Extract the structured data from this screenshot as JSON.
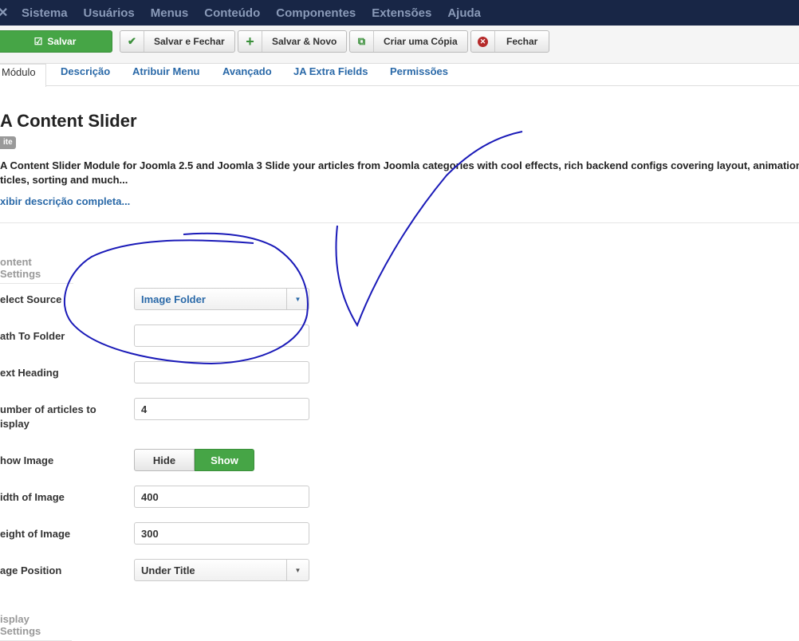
{
  "nav": {
    "items": [
      "Sistema",
      "Usuários",
      "Menus",
      "Conteúdo",
      "Componentes",
      "Extensões",
      "Ajuda"
    ]
  },
  "toolbar": {
    "save": "Salvar",
    "save_close": "Salvar e Fechar",
    "save_new": "Salvar & Novo",
    "save_copy": "Criar uma Cópia",
    "close": "Fechar"
  },
  "tabs": [
    "Módulo",
    "Descrição",
    "Atribuir Menu",
    "Avançado",
    "JA Extra Fields",
    "Permissões"
  ],
  "module": {
    "title": "A Content Slider",
    "badge": "ite",
    "description_line1": "A Content Slider Module for Joomla 2.5 and Joomla 3 Slide your articles from Joomla categories with cool effects, rich backend configs covering layout, animation",
    "description_line2": "ticles, sorting and much...",
    "more_link": "xibir descrição completa..."
  },
  "form": {
    "content_legend": "ontent Settings",
    "select_source_label": "elect Source",
    "select_source_value": "Image Folder",
    "path_label": "ath To Folder",
    "path_value": "",
    "heading_label": "ext Heading",
    "heading_value": "",
    "num_articles_label_1": "umber of articles to",
    "num_articles_label_2": "isplay",
    "num_articles_value": "4",
    "show_image_label": "how Image",
    "hide": "Hide",
    "show": "Show",
    "width_label": "idth of Image",
    "width_value": "400",
    "height_label": "eight of Image",
    "height_value": "300",
    "position_label": "age Position",
    "position_value": "Under Title",
    "display_legend": "isplay Settings"
  },
  "colors": {
    "nav": "#182646",
    "link": "#2a69a8",
    "green": "#46a546",
    "ink": "#1a1ab8"
  }
}
